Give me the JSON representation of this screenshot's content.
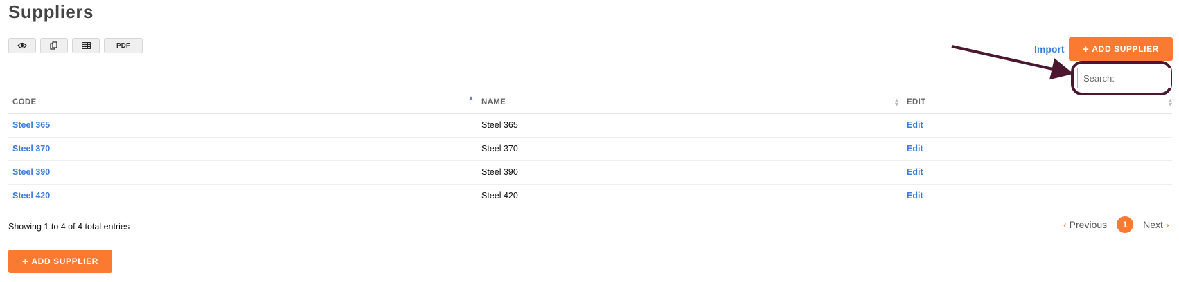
{
  "page": {
    "title": "Suppliers"
  },
  "toolbar": {
    "buttons": [
      {
        "icon": "eye-icon"
      },
      {
        "icon": "copy-icon"
      },
      {
        "icon": "table-icon"
      },
      {
        "label": "PDF"
      }
    ]
  },
  "actions": {
    "import_label": "Import",
    "add_supplier_label": "ADD SUPPLIER"
  },
  "search": {
    "placeholder": "Search:"
  },
  "table": {
    "headers": {
      "code": "CODE",
      "name": "NAME",
      "edit": "EDIT"
    },
    "rows": [
      {
        "code": "Steel 365",
        "name": "Steel 365",
        "edit": "Edit"
      },
      {
        "code": "Steel 370",
        "name": "Steel 370",
        "edit": "Edit"
      },
      {
        "code": "Steel 390",
        "name": "Steel 390",
        "edit": "Edit"
      },
      {
        "code": "Steel 420",
        "name": "Steel 420",
        "edit": "Edit"
      }
    ]
  },
  "footer": {
    "info": "Showing 1 to 4 of 4 total entries",
    "pagination": {
      "previous": "Previous",
      "current": "1",
      "next": "Next"
    }
  },
  "colors": {
    "accent": "#f97a30",
    "link": "#3b7ddd",
    "annotation": "#4b1730"
  }
}
